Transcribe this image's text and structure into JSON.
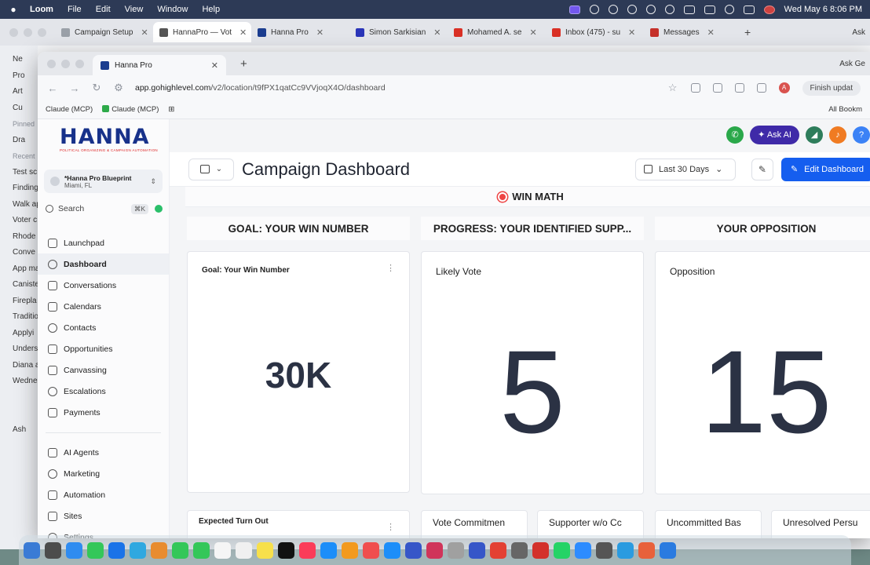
{
  "menubar": {
    "app": "Loom",
    "items": [
      "File",
      "Edit",
      "View",
      "Window",
      "Help"
    ],
    "clock": "Wed May 6  8:06 PM"
  },
  "back_window": {
    "tabs": [
      {
        "label": "Campaign Setup",
        "color": "#9aa0a8"
      },
      {
        "label": "HannaPro — Vot",
        "color": "#555555",
        "active": true
      },
      {
        "label": "Hanna Pro",
        "color": "#1b3d8f"
      },
      {
        "label": "Simon Sarkisian",
        "color": "#2a35b8"
      },
      {
        "label": "Mohamed A. se",
        "color": "#d93025"
      },
      {
        "label": "Inbox (475) - su",
        "color": "#d93025"
      },
      {
        "label": "Messages",
        "color": "#c5302a"
      }
    ],
    "ask": "Ask",
    "sidebar": [
      "Ne",
      "Pro",
      "Art",
      "Cu",
      "Pinned",
      "Dra",
      "Recent",
      "Test sc",
      "Finding",
      "Walk ap",
      "Voter c",
      "Rhode",
      "Conve",
      "App ma",
      "Caniste",
      "Firepla",
      "Traditio",
      "Applyi",
      "Unders",
      "Diana a",
      "Wedne",
      "",
      "",
      "Ash"
    ]
  },
  "window": {
    "tab_title": "Hanna Pro",
    "ask_gemini": "Ask Ge",
    "url_host": "app.gohighlevel.com",
    "url_path": "/v2/location/t9fPX1qatCc9VVjoqX4O/dashboard",
    "finish_update": "Finish updat",
    "bookmarks": [
      "Claude (MCP)",
      "Claude (MCP)"
    ],
    "all_bookmarks": "All Bookm"
  },
  "sidebar": {
    "logo": "HANNA",
    "logo_tagline": "POLITICAL ORGANIZING & CAMPAIGN AUTOMATION",
    "location_name": "*Hanna Pro Blueprint",
    "location_city": "Miami, FL",
    "search_placeholder": "Search",
    "search_shortcut": "⌘K",
    "nav_primary": [
      "Launchpad",
      "Dashboard",
      "Conversations",
      "Calendars",
      "Contacts",
      "Opportunities",
      "Canvassing",
      "Escalations",
      "Payments"
    ],
    "nav_secondary": [
      "AI Agents",
      "Marketing",
      "Automation",
      "Sites",
      "Settings"
    ],
    "active": "Dashboard"
  },
  "header": {
    "ask_ai": "Ask AI",
    "help": "?",
    "title": "Campaign Dashboard",
    "date_range": "Last 30 Days",
    "edit_label": "Edit Dashboard"
  },
  "dashboard": {
    "section_title": "WIN MATH",
    "columns": [
      "GOAL: YOUR WIN NUMBER",
      "PROGRESS: YOUR IDENTIFIED SUPP...",
      "YOUR OPPOSITION"
    ],
    "cards": [
      {
        "label": "Goal: Your Win Number",
        "value": "30K"
      },
      {
        "label": "Likely Vote",
        "value": "5"
      },
      {
        "label": "Opposition",
        "value": "15"
      }
    ],
    "bottom_cards": [
      "Expected Turn Out",
      "Vote Commitmen",
      "Supporter w/o Cc",
      "Uncommitted Bas",
      "Unresolved Persu"
    ]
  },
  "dock": {
    "colors": [
      "#3a7bd5",
      "#4c4c4c",
      "#2f8cf0",
      "#34c759",
      "#1a73e8",
      "#2fa8e0",
      "#e88c2f",
      "#34c759",
      "#34c759",
      "#f5f5f5",
      "#f0f0f0",
      "#f7e04b",
      "#111111",
      "#fb3c59",
      "#1c8ef9",
      "#f39a1e",
      "#f04e4e",
      "#1c8ef9",
      "#3656c8",
      "#d0345a",
      "#a0a0a0",
      "#3656c8",
      "#e34133",
      "#666666",
      "#d3312b",
      "#25d366",
      "#2d8cff",
      "#555555",
      "#2a9be0",
      "#e8613b",
      "#2a7be0"
    ]
  }
}
